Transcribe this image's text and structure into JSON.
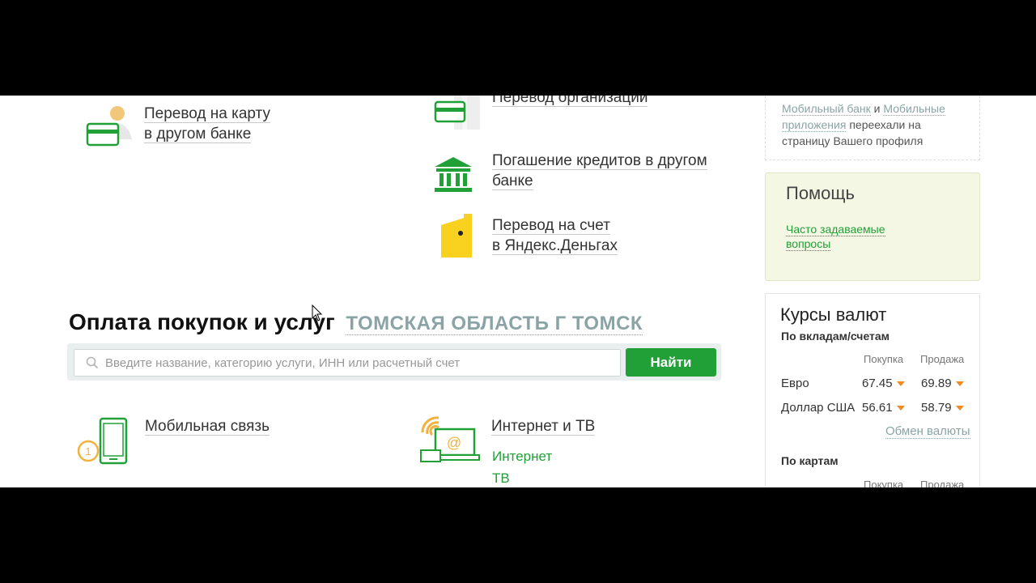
{
  "transfers": {
    "card_other_bank": [
      "Перевод на карту",
      "в другом банке"
    ],
    "to_organization": [
      "Перевод организации"
    ],
    "loan_repayment": [
      "Погашение кредитов в другом",
      "банке"
    ],
    "yandex_money": [
      "Перевод на счет",
      "в Яндекс.Деньгах"
    ]
  },
  "payments": {
    "title": "Оплата покупок и услуг",
    "region": "ТОМСКАЯ ОБЛАСТЬ Г ТОМСК",
    "search_placeholder": "Введите название, категорию услуги, ИНН или расчетный счет",
    "search_button": "Найти",
    "categories": {
      "mobile": "Мобильная связь",
      "internet_tv": "Интернет и ТВ",
      "internet": "Интернет",
      "tv": "ТВ"
    }
  },
  "sidebar": {
    "moved_notice": {
      "link1": "Мобильный банк",
      "and": " и ",
      "link2": "Мобильные приложения",
      "rest": " переехали на страницу Вашего профиля"
    },
    "help": {
      "title": "Помощь",
      "faq": "Часто задаваемые вопросы"
    },
    "rates": {
      "title": "Курсы валют",
      "deposits_label": "По вкладам/счетам",
      "buy_label": "Покупка",
      "sell_label": "Продажа",
      "rows": [
        {
          "currency": "Евро",
          "buy": "67.45",
          "sell": "69.89"
        },
        {
          "currency": "Доллар США",
          "buy": "56.61",
          "sell": "58.79"
        }
      ],
      "exchange_link": "Обмен валюты",
      "cards_label": "По картам",
      "buy_label_2": "Покупка",
      "sell_label_2": "Продажа"
    }
  },
  "colors": {
    "accent_green": "#21a038",
    "region_gray": "#8aa4a6",
    "help_bg": "#f4f7e4",
    "down_arrow": "#f08a24"
  }
}
